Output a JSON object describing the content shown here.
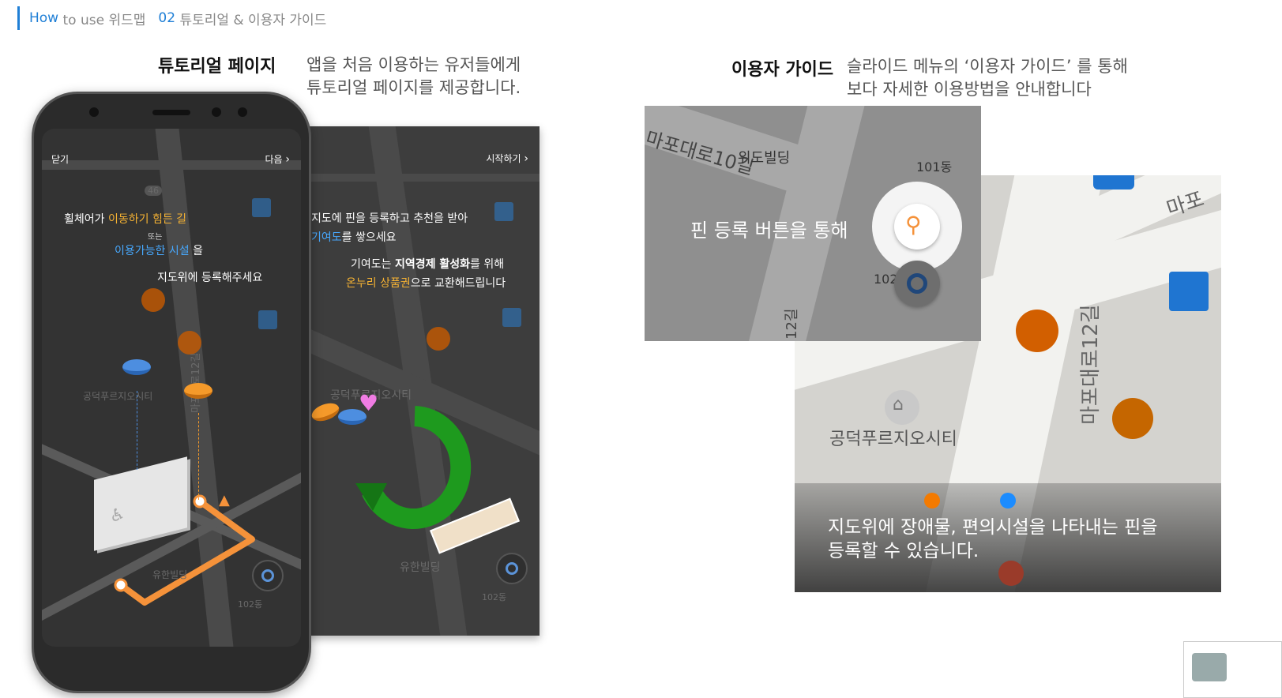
{
  "breadcrumb": {
    "how": "How",
    "to_use": "to use 위드맵",
    "num": "02",
    "title": "튜토리얼 & 이용자 가이드"
  },
  "tutorial": {
    "title": "튜토리얼 페이지",
    "desc_line1": "앱을 처음 이용하는 유저들에게",
    "desc_line2": "튜토리얼 페이지를 제공합니다."
  },
  "guide": {
    "title": "이용자 가이드",
    "desc_line1": "슬라이드 메뉴의 ‘이용자 가이드’ 를 통해",
    "desc_line2": "보다 자세한 이용방법을 안내합니다"
  },
  "screen1": {
    "close": "닫기",
    "next": "다음",
    "line1_pre": "휠체어가 ",
    "line1_hl": "이동하기 힘든 길",
    "line2": "또는",
    "line3_hl": "이용가능한 시설",
    "line3_post": " 을",
    "line4": "지도위에 등록해주세요",
    "place": "공덕푸르지오시티",
    "road": "마포대로12길",
    "bldg": "유한빌딩",
    "dong": "102동",
    "num46": "46"
  },
  "screen2": {
    "start": "시작하기",
    "line1": "지도에 핀을 등록하고 추천을 받아",
    "line2_hl": "기여도",
    "line2_post": "를 쌓으세요",
    "line3_pre": "기여도는 ",
    "line3_bold": "지역경제 활성화",
    "line3_post": "를 위해",
    "line4_hl": "온누리 상품권",
    "line4_post": "으로 교환해드립니다",
    "bldg": "유한빌딩",
    "dong": "102동",
    "place": "공덕푸르지오시티"
  },
  "guide_map": {
    "label_widobuilding": "위도빌딩",
    "label_road10": "마포대로10길",
    "label_101": "101동",
    "label_102": "102",
    "label_12gil": "12길",
    "caption_pin": "핀 등록 버튼을 통해",
    "place": "공덕푸르지오시티",
    "road": "마포대로12길",
    "mapo": "마포",
    "caption_line1": "지도위에 장애물, 편의시설을 나타내는 핀을",
    "caption_line2": "등록할 수 있습니다."
  },
  "colors": {
    "accent_blue": "#1f7fd6",
    "highlight_yellow": "#f5b233",
    "highlight_cyan": "#47a9ff",
    "poi_orange": "#c75a00",
    "pin_orange": "#f59a2a",
    "pin_blue": "#4d8ee0"
  }
}
